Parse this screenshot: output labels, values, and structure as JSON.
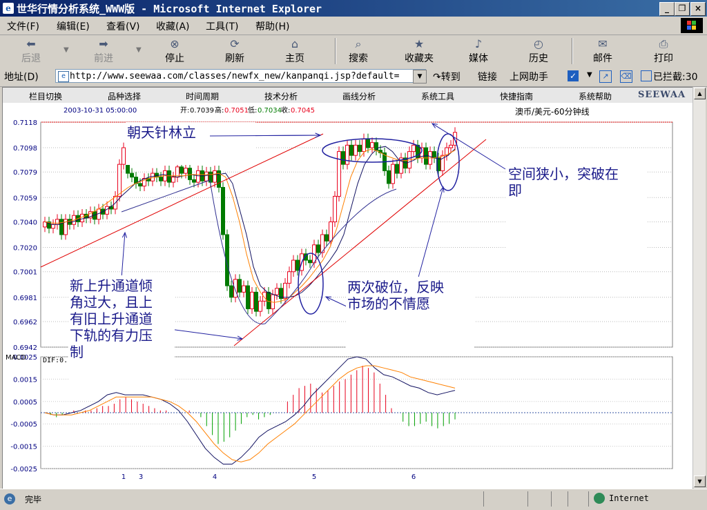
{
  "window": {
    "title": "世华行情分析系统_WWW版 - Microsoft Internet Explorer",
    "icon": "ie-icon"
  },
  "menubar": {
    "items": [
      "文件(F)",
      "编辑(E)",
      "查看(V)",
      "收藏(A)",
      "工具(T)",
      "帮助(H)"
    ]
  },
  "toolbar": {
    "items": [
      {
        "label": "后退",
        "icon": "back-arrow-icon"
      },
      {
        "label": "前进",
        "icon": "forward-arrow-icon"
      },
      {
        "label": "停止",
        "icon": "stop-icon"
      },
      {
        "label": "刷新",
        "icon": "refresh-icon"
      },
      {
        "label": "主页",
        "icon": "home-icon"
      },
      {
        "label": "搜索",
        "icon": "search-icon"
      },
      {
        "label": "收藏夹",
        "icon": "favorites-icon"
      },
      {
        "label": "媒体",
        "icon": "media-icon"
      },
      {
        "label": "历史",
        "icon": "history-icon"
      },
      {
        "label": "邮件",
        "icon": "mail-icon"
      },
      {
        "label": "打印",
        "icon": "print-icon"
      }
    ]
  },
  "addressbar": {
    "label": "地址(D)",
    "url": "http://www.seewaa.com/classes/newfx_new/kanpanqi.jsp?default=",
    "go": "转到",
    "links": "链接",
    "assistant": "上网助手",
    "blocked": "已拦截:30"
  },
  "app": {
    "nav": [
      "栏目切换",
      "品种选择",
      "时间周期",
      "技术分析",
      "画线分析",
      "系统工具",
      "快捷指南",
      "系统帮助"
    ],
    "logo": "SEEWAA",
    "datetime": "2003-10-31 05:00:00",
    "quote_open_label": "开:",
    "quote_open": "0.7039",
    "quote_high_label": "高:",
    "quote_high": "0.7051",
    "quote_low_label": "低:",
    "quote_low": "0.7034",
    "quote_close_label": "收:",
    "quote_close": "0.7045",
    "instrument": "澳币/美元-60分钟线",
    "macd_label": "MACD",
    "dif_label": "DIF:0."
  },
  "annotations": {
    "a1": "朝天针林立",
    "a2_l1": "空间狭小，突破在",
    "a2_l2": "即",
    "a3_l1": "新上升通道倾",
    "a3_l2": "角过大，且上",
    "a3_l3": "有旧上升通道",
    "a3_l4": "下轨的有力压",
    "a3_l5": "制",
    "a4_l1": "两次破位，反映",
    "a4_l2": "市场的不情愿"
  },
  "chart_data": [
    {
      "type": "candlestick",
      "title": "澳币/美元-60分钟线",
      "y_ticks": [
        "0.7118",
        "0.7098",
        "0.7079",
        "0.7059",
        "0.7040",
        "0.7020",
        "0.7001",
        "0.6981",
        "0.6962",
        "0.6942"
      ],
      "ylim": [
        0.6942,
        0.7118
      ],
      "x_markers": [
        "1",
        "3",
        "4",
        "5",
        "6"
      ],
      "colors": {
        "up": "#e8001c",
        "down": "#007a00",
        "ma_fast": "#101060",
        "ma_slow": "#ff8000",
        "trendline": "#e00000"
      },
      "closes": [
        0.704,
        0.7035,
        0.7038,
        0.7042,
        0.703,
        0.7042,
        0.7038,
        0.7045,
        0.704,
        0.7046,
        0.7043,
        0.7048,
        0.7042,
        0.705,
        0.7046,
        0.7052,
        0.705,
        0.706,
        0.7085,
        0.7098,
        0.7078,
        0.7075,
        0.707,
        0.7068,
        0.7074,
        0.7072,
        0.7078,
        0.7075,
        0.7072,
        0.708,
        0.7071,
        0.7075,
        0.7083,
        0.7078,
        0.7082,
        0.7073,
        0.7071,
        0.708,
        0.7072,
        0.7079,
        0.7071,
        0.708,
        0.7067,
        0.703,
        0.699,
        0.6981,
        0.6995,
        0.6985,
        0.699,
        0.6972,
        0.6985,
        0.697,
        0.6978,
        0.6985,
        0.6972,
        0.6983,
        0.6988,
        0.698,
        0.6992,
        0.7001,
        0.701,
        0.7002,
        0.7015,
        0.701,
        0.7008,
        0.7022,
        0.7016,
        0.703,
        0.7025,
        0.704,
        0.706,
        0.7095,
        0.7085,
        0.71,
        0.7092,
        0.71,
        0.7095,
        0.7105,
        0.7098,
        0.7102,
        0.7096,
        0.7094,
        0.708,
        0.707,
        0.7085,
        0.7078,
        0.709,
        0.7082,
        0.7095,
        0.71,
        0.709,
        0.7098,
        0.7085,
        0.7095,
        0.709,
        0.708,
        0.7092,
        0.7098,
        0.71,
        0.711
      ],
      "ma_fast": [
        0.704,
        0.7038,
        0.7038,
        0.704,
        0.704,
        0.7042,
        0.7043,
        0.7045,
        0.7047,
        0.705,
        0.7054,
        0.706,
        0.7065,
        0.707,
        0.7073,
        0.7075,
        0.7076,
        0.7077,
        0.7076,
        0.7075,
        0.7076,
        0.7077,
        0.7076,
        0.7076,
        0.7077,
        0.7077,
        0.7078,
        0.707,
        0.705,
        0.703,
        0.7005,
        0.699,
        0.6985,
        0.6983,
        0.6981,
        0.6981,
        0.6982,
        0.6985,
        0.699,
        0.6996,
        0.7003,
        0.701,
        0.7018,
        0.703,
        0.705,
        0.707,
        0.7085,
        0.7093,
        0.7098,
        0.7099,
        0.7095,
        0.7088,
        0.7086,
        0.7088,
        0.7091,
        0.7092,
        0.709,
        0.7089,
        0.7092,
        0.7097
      ],
      "ma_slow": [
        0.704,
        0.7039,
        0.7039,
        0.704,
        0.7041,
        0.7043,
        0.7045,
        0.7048,
        0.7051,
        0.7055,
        0.7059,
        0.7063,
        0.7067,
        0.707,
        0.7072,
        0.7074,
        0.7075,
        0.7076,
        0.7076,
        0.7076,
        0.7076,
        0.7077,
        0.7077,
        0.7077,
        0.7077,
        0.7078,
        0.7075,
        0.706,
        0.704,
        0.7015,
        0.6995,
        0.6985,
        0.6978,
        0.6977,
        0.6978,
        0.698,
        0.6985,
        0.699,
        0.6996,
        0.7003,
        0.701,
        0.702,
        0.7035,
        0.7055,
        0.7075,
        0.7088,
        0.7095,
        0.7097,
        0.7095,
        0.7092,
        0.709,
        0.7088,
        0.7088,
        0.7089,
        0.709,
        0.709,
        0.709,
        0.7091,
        0.7093,
        0.7096
      ]
    },
    {
      "type": "bar",
      "title": "MACD",
      "y_ticks": [
        "0.0025",
        "0.0015",
        "0.0005",
        "-0.0005",
        "-0.0015",
        "-0.0025"
      ],
      "ylim": [
        -0.0025,
        0.0025
      ],
      "hist": [
        0.0,
        -0.0001,
        -0.0002,
        -0.0001,
        0.0,
        0.0001,
        0.0,
        0.0001,
        0.0001,
        0.0002,
        0.0003,
        0.0003,
        0.0004,
        0.0006,
        0.0007,
        0.0006,
        0.0005,
        0.0004,
        0.0003,
        0.0002,
        0.0001,
        0.0001,
        0.0,
        0.0,
        0.0,
        0.0001,
        0.0,
        -0.0002,
        -0.0006,
        -0.001,
        -0.0014,
        -0.0013,
        -0.0011,
        -0.0008,
        -0.0005,
        -0.0002,
        -0.0001,
        -0.0003,
        -0.0002,
        -0.0001,
        0.0,
        0.0,
        0.0005,
        0.0008,
        0.0011,
        0.0012,
        0.0013,
        0.0011,
        0.0009,
        0.001,
        0.0012,
        0.0014,
        0.0015,
        0.0017,
        0.0019,
        0.0021,
        0.002,
        0.0018,
        0.0013,
        0.0008,
        0.0002,
        0.0,
        -0.0004,
        -0.0006,
        -0.0006,
        -0.0005,
        -0.0004,
        -0.0006,
        -0.0007,
        -0.0006,
        -0.0005,
        -0.0003
      ],
      "dif": [
        0.0,
        -0.0001,
        -0.0001,
        0.0,
        0.0001,
        0.0003,
        0.0005,
        0.0008,
        0.0009,
        0.0008,
        0.0008,
        0.0008,
        0.0007,
        0.0006,
        0.0004,
        0.0001,
        -0.0004,
        -0.001,
        -0.0016,
        -0.002,
        -0.0023,
        -0.0023,
        -0.002,
        -0.0016,
        -0.0011,
        -0.0008,
        -0.0006,
        -0.0004,
        -0.0001,
        0.0003,
        0.0008,
        0.0012,
        0.0016,
        0.002,
        0.0024,
        0.0025,
        0.0024,
        0.002,
        0.0017,
        0.0016,
        0.0014,
        0.0012,
        0.0011,
        0.0009,
        0.0008,
        0.0009,
        0.001
      ],
      "dea": [
        0.0,
        -0.0001,
        -0.0001,
        -0.0001,
        0.0,
        0.0001,
        0.0003,
        0.0005,
        0.0007,
        0.0007,
        0.0007,
        0.0007,
        0.0007,
        0.0006,
        0.0005,
        0.0003,
        0.0,
        -0.0004,
        -0.0009,
        -0.0014,
        -0.0018,
        -0.0021,
        -0.0022,
        -0.0021,
        -0.0018,
        -0.0014,
        -0.0011,
        -0.0008,
        -0.0005,
        -0.0001,
        0.0003,
        0.0007,
        0.0011,
        0.0015,
        0.0018,
        0.002,
        0.0021,
        0.0021,
        0.002,
        0.0019,
        0.0018,
        0.0016,
        0.0015,
        0.0014,
        0.0013,
        0.0012,
        0.0011
      ]
    }
  ],
  "status": {
    "text": "完毕",
    "zone": "Internet"
  }
}
